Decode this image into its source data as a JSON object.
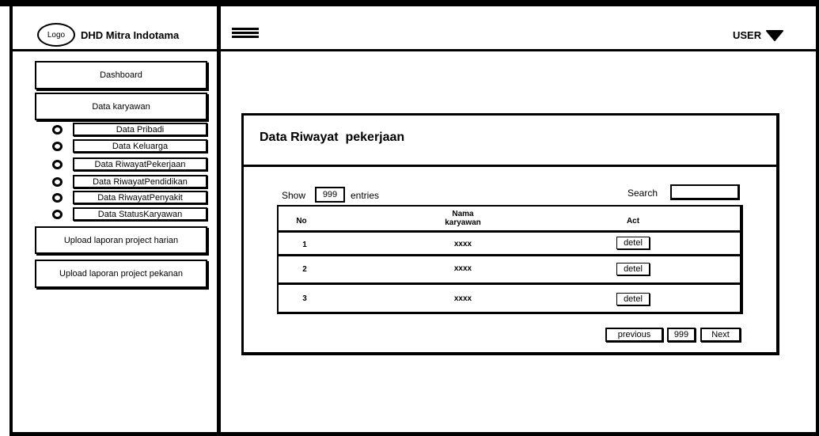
{
  "brand": {
    "logo_text": "Logo",
    "name": "DHD Mitra Indotama"
  },
  "header": {
    "menu_icon": "hamburger-icon",
    "user_label": "USER",
    "user_icon": "caret-down-icon"
  },
  "sidebar": {
    "dashboard": "Dashboard",
    "data_karyawan": "Data karyawan",
    "sub_items": [
      "Data Pribadi",
      "Data Keluarga",
      "Data RiwayatPekerjaan",
      "Data RiwayatPendidikan",
      "Data RiwayatPenyakit",
      "Data StatusKaryawan"
    ],
    "upload_harian": "Upload laporan project harian",
    "upload_pekanan": "Upload laporan project pekanan"
  },
  "main": {
    "title": "Data Riwayat  pekerjaan",
    "show_label": "Show",
    "show_value": "999",
    "entries_label": "entries",
    "search_label": "Search",
    "search_value": "",
    "table": {
      "headers": {
        "no": "No",
        "nama_line1": "Nama",
        "nama_line2": "karyawan",
        "act": "Act"
      },
      "rows": [
        {
          "no": "1",
          "nama": "xxxx",
          "act": "detel"
        },
        {
          "no": "2",
          "nama": "xxxx",
          "act": "detel"
        },
        {
          "no": "3",
          "nama": "xxxx",
          "act": "detel"
        }
      ]
    },
    "pagination": {
      "previous": "previous",
      "page": "999",
      "next": "Next"
    }
  }
}
